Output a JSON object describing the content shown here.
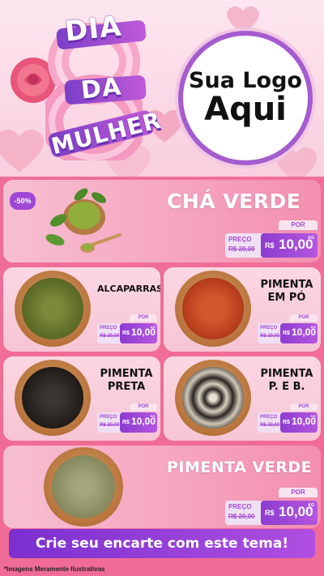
{
  "header": {
    "title_words": [
      "DIA",
      "8",
      "DA",
      "MULHER"
    ],
    "logo_line1": "Sua Logo",
    "logo_line2": "Aqui"
  },
  "products": [
    {
      "name": "CHÁ VERDE",
      "badge": "-50%",
      "por": "POR",
      "preco_label": "PREÇO",
      "old_price": "R$ 20,00",
      "currency": "R$",
      "new_price": "10,00",
      "unit": "KG"
    },
    {
      "name": "ALCAPARRAS",
      "por": "POR",
      "preco_label": "PREÇO",
      "old_price": "R$ 20,00",
      "currency": "R$",
      "new_price": "10,00",
      "unit": "KG"
    },
    {
      "name": "PIMENTA\nEM PÓ",
      "por": "POR",
      "preco_label": "PREÇO",
      "old_price": "R$ 20,00",
      "currency": "R$",
      "new_price": "10,00",
      "unit": "KG"
    },
    {
      "name": "PIMENTA\nPRETA",
      "por": "POR",
      "preco_label": "PREÇO",
      "old_price": "R$ 20,00",
      "currency": "R$",
      "new_price": "10,00",
      "unit": "KG"
    },
    {
      "name": "PIMENTA\nP. E B.",
      "por": "POR",
      "preco_label": "PREÇO",
      "old_price": "R$ 20,00",
      "currency": "R$",
      "new_price": "10,00",
      "unit": "KG"
    },
    {
      "name": "PIMENTA VERDE",
      "por": "POR",
      "preco_label": "PREÇO",
      "old_price": "R$ 20,00",
      "currency": "R$",
      "new_price": "10,00",
      "unit": "KG"
    }
  ],
  "cta": "Crie seu encarte com este tema!",
  "disclaimer": "*Imagens Meramente Ilustrativas",
  "colors": {
    "pink": "#f06b95",
    "purple": "#9b45d6",
    "light_pink": "#fbd7e3"
  }
}
